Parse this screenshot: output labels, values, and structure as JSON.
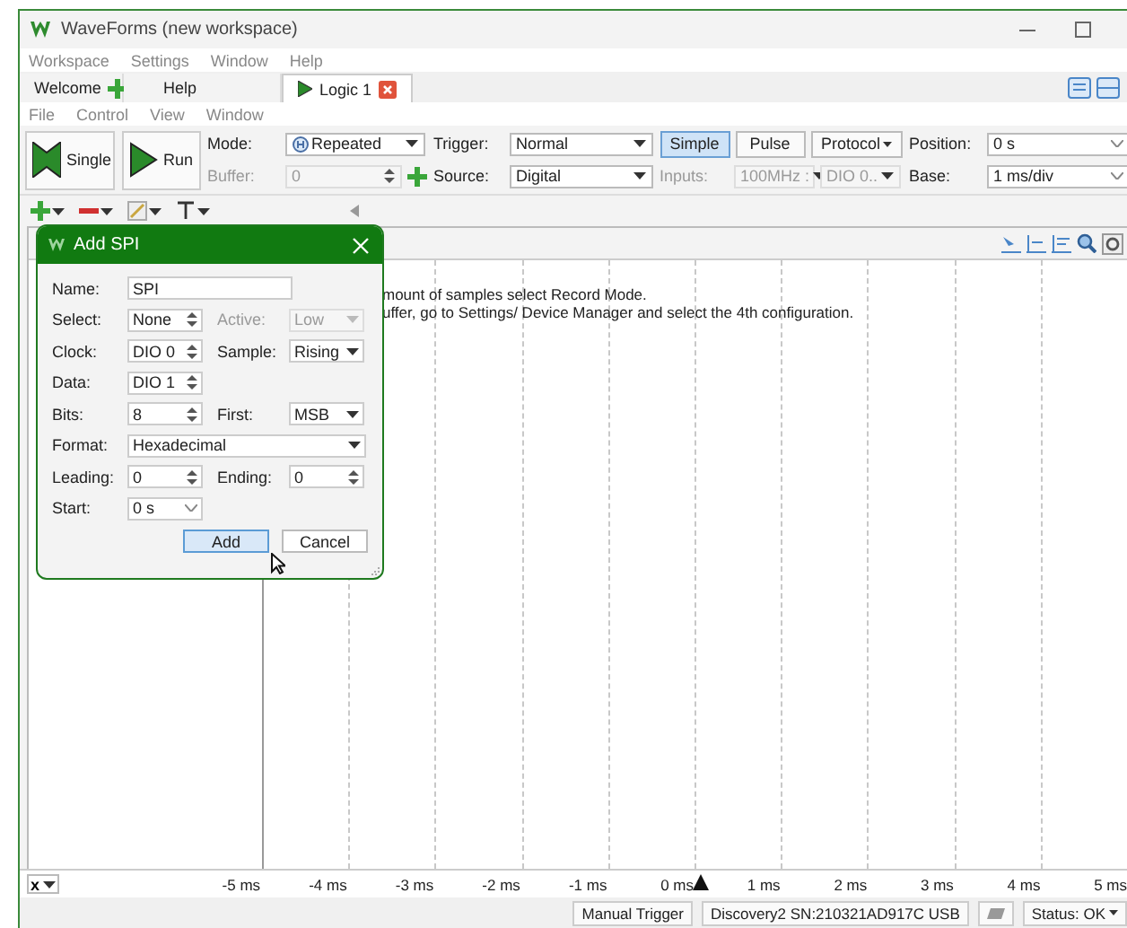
{
  "window": {
    "title": "WaveForms (new workspace)"
  },
  "menu": [
    "Workspace",
    "Settings",
    "Window",
    "Help"
  ],
  "tabs": [
    {
      "label": "Welcome",
      "kind": "start",
      "selected": false
    },
    {
      "label": "Help",
      "kind": "plain",
      "selected": false
    },
    {
      "label": "Logic 1",
      "kind": "instrument",
      "selected": true
    }
  ],
  "submenu": [
    "File",
    "Control",
    "View",
    "Window"
  ],
  "toolbar": {
    "buttons": [
      {
        "label": "Single",
        "kind": "single"
      },
      {
        "label": "Run",
        "kind": "run"
      }
    ],
    "columns": [
      {
        "rows": [
          {
            "label": "Mode:",
            "disabled": false,
            "controls": [
              {
                "kind": "icon-combo",
                "value": "Repeated"
              }
            ]
          },
          {
            "label": "Buffer:",
            "disabled": true,
            "controls": [
              {
                "kind": "spin",
                "value": "0"
              },
              {
                "kind": "add"
              }
            ]
          }
        ]
      },
      {
        "rows": [
          {
            "label": "Trigger:",
            "disabled": false,
            "controls": [
              {
                "kind": "combo",
                "value": "Normal"
              }
            ]
          },
          {
            "label": "Source:",
            "disabled": false,
            "controls": [
              {
                "kind": "combo",
                "value": "Digital"
              }
            ]
          }
        ]
      },
      {
        "rows": [
          {
            "controls": [
              {
                "kind": "toggle",
                "value": "Simple",
                "selected": true
              },
              {
                "kind": "toggle",
                "value": "Pulse",
                "selected": false
              },
              {
                "kind": "menu-button",
                "value": "Protocol"
              }
            ]
          },
          {
            "label": "Inputs:",
            "disabled": true,
            "controls": [
              {
                "kind": "combo",
                "value": "100MHz :"
              },
              {
                "kind": "combo",
                "value": "DIO 0.."
              }
            ]
          }
        ]
      },
      {
        "rows": [
          {
            "label": "Position:",
            "disabled": false,
            "controls": [
              {
                "kind": "dropdown",
                "value": "0 s"
              }
            ]
          },
          {
            "label": "Base:",
            "disabled": false,
            "controls": [
              {
                "kind": "dropdown",
                "value": "1 ms/div"
              }
            ]
          }
        ]
      }
    ]
  },
  "plot": {
    "messages": [
      "mount of samples select Record Mode.",
      "uffer, go to Settings/ Device Manager and select the 4th configuration."
    ],
    "axis": {
      "button": "x",
      "ticks": [
        "-5 ms",
        "-4 ms",
        "-3 ms",
        "-2 ms",
        "-1 ms",
        "0 ms",
        "1 ms",
        "2 ms",
        "3 ms",
        "4 ms",
        "5 ms"
      ]
    }
  },
  "dialog": {
    "title": "Add SPI",
    "rows": [
      {
        "items": [
          {
            "label": "Name:",
            "kind": "text",
            "value": "SPI",
            "disabled": false
          }
        ]
      },
      {
        "items": [
          {
            "label": "Select:",
            "kind": "spin",
            "value": "None",
            "disabled": false
          },
          {
            "label": "Active:",
            "kind": "combo",
            "value": "Low",
            "disabled": true
          }
        ]
      },
      {
        "items": [
          {
            "label": "Clock:",
            "kind": "spin",
            "value": "DIO 0",
            "disabled": false
          },
          {
            "label": "Sample:",
            "kind": "combo",
            "value": "Rising",
            "disabled": false
          }
        ]
      },
      {
        "items": [
          {
            "label": "Data:",
            "kind": "spin",
            "value": "DIO 1",
            "disabled": false
          }
        ]
      },
      {
        "items": [
          {
            "label": "Bits:",
            "kind": "spin",
            "value": "8",
            "disabled": false
          },
          {
            "label": "First:",
            "kind": "combo",
            "value": "MSB",
            "disabled": false
          }
        ]
      },
      {
        "items": [
          {
            "label": "Format:",
            "kind": "combo",
            "value": "Hexadecimal",
            "disabled": false
          }
        ]
      },
      {
        "items": [
          {
            "label": "Leading:",
            "kind": "spin",
            "value": "0",
            "disabled": false
          },
          {
            "label": "Ending:",
            "kind": "spin",
            "value": "0",
            "disabled": false
          }
        ]
      },
      {
        "items": [
          {
            "label": "Start:",
            "kind": "dropdown",
            "value": "0 s",
            "disabled": false
          }
        ]
      }
    ],
    "buttons": [
      {
        "label": "Add",
        "default": true
      },
      {
        "label": "Cancel",
        "default": false
      }
    ]
  },
  "status_bar": {
    "trigger_button": "Manual Trigger",
    "device": "Discovery2 SN:210321AD917C USB",
    "status": "Status: OK"
  }
}
